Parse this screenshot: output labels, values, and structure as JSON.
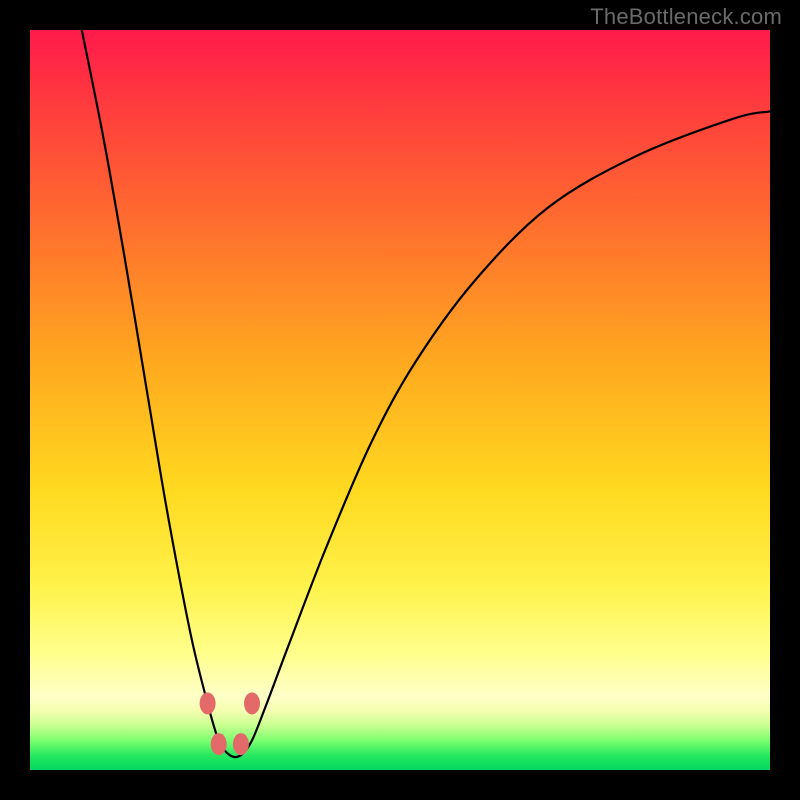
{
  "watermark": "TheBottleneck.com",
  "colors": {
    "background": "#000000",
    "gradient_top": "#ff1a4b",
    "gradient_bottom": "#00d860",
    "curve": "#000000",
    "dots": "#e46a6a"
  },
  "chart_data": {
    "type": "line",
    "title": "",
    "xlabel": "",
    "ylabel": "",
    "xlim": [
      0,
      100
    ],
    "ylim": [
      0,
      100
    ],
    "grid": false,
    "series": [
      {
        "name": "bottleneck-curve",
        "x": [
          7,
          10,
          13,
          16,
          18,
          20,
          22,
          24,
          25.5,
          27,
          28.5,
          30,
          32,
          35,
          40,
          46,
          52,
          60,
          70,
          82,
          95,
          100
        ],
        "values": [
          100,
          85,
          68,
          50,
          38,
          27,
          17,
          9,
          4,
          2,
          2,
          4,
          9,
          17,
          30,
          44,
          55,
          66,
          76,
          83,
          88,
          89
        ]
      }
    ],
    "annotations": {
      "dots": [
        {
          "x": 24.0,
          "y": 9.0
        },
        {
          "x": 25.5,
          "y": 3.5
        },
        {
          "x": 28.5,
          "y": 3.5
        },
        {
          "x": 30.0,
          "y": 9.0
        }
      ]
    }
  }
}
